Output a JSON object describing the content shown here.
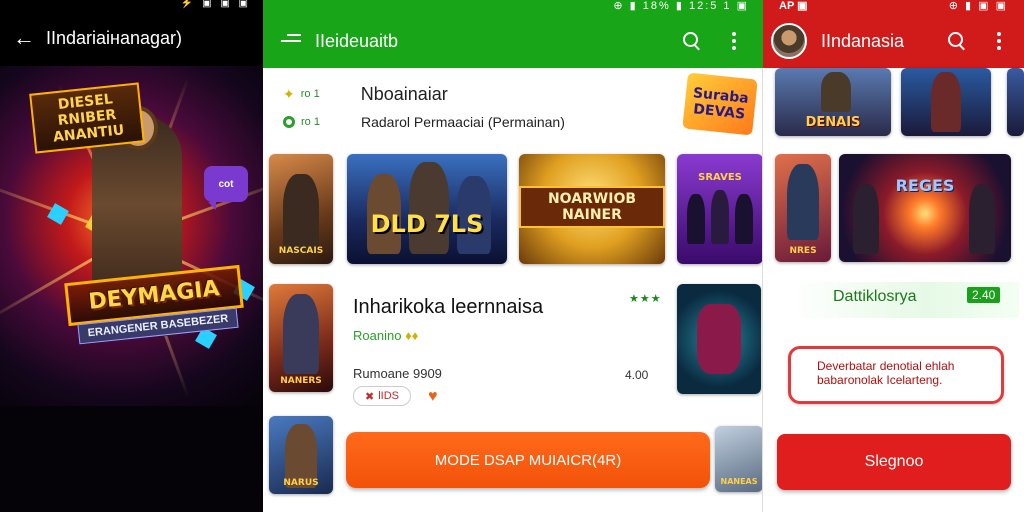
{
  "left": {
    "status_icons": "⚡ ▣ ▣ ▣",
    "title": "IIndariaiнanagar)",
    "hero": {
      "banner_top": "DIESEL RNIBER ANANTIU",
      "logo": "DEYMAGIA",
      "subtitle": "ERANGENER BASEBEZER",
      "bubble": "cot"
    }
  },
  "middle": {
    "status_right": "⊕ ▮ 18% ▮ 12:5 1 ▣",
    "title": "IIeideuaitb",
    "section": {
      "rank": "ro 1",
      "title": "Nboainaiar",
      "rank2": "ro 1",
      "subtitle": "Radarol Permaaciai (Permainan)"
    },
    "corner_logo": "Suraba DEVAS",
    "thumbs": [
      {
        "caption": "NASCAIS"
      },
      {
        "caption": "DLD 7LS"
      },
      {
        "caption": "NOARWIOB NAINER"
      },
      {
        "caption": "SRAVES"
      },
      {
        "caption": "NANERS"
      },
      {
        "caption": ""
      },
      {
        "caption": "NARUS"
      },
      {
        "caption": "NANEAS"
      }
    ],
    "featured": {
      "title": "Inharikoka leernnaisa",
      "developer": "Roanino",
      "meta": "Rumoane 9909",
      "price": "4.00",
      "rating_chip": "lIDS",
      "stars": "★★★"
    },
    "cta_label": "MODE DSAP MUIAICR(4R)"
  },
  "right": {
    "status_left": "AP ▣",
    "status_right": "⊕ ▮ ▣ ▣",
    "title": "IIndanasia",
    "top_caption": "DENAIS",
    "tile_caption": "REGES",
    "side_caption": "NRES",
    "promo_label": "Dattiklosrya",
    "promo_badge": "2.40",
    "notice": "Deverbatar denotial ehlah babaronolak Icelarteng.",
    "button_label": "Slegnoo"
  },
  "colors": {
    "middle_accent": "#18a518",
    "right_accent": "#d11b1b",
    "cta": "#f2520a"
  }
}
